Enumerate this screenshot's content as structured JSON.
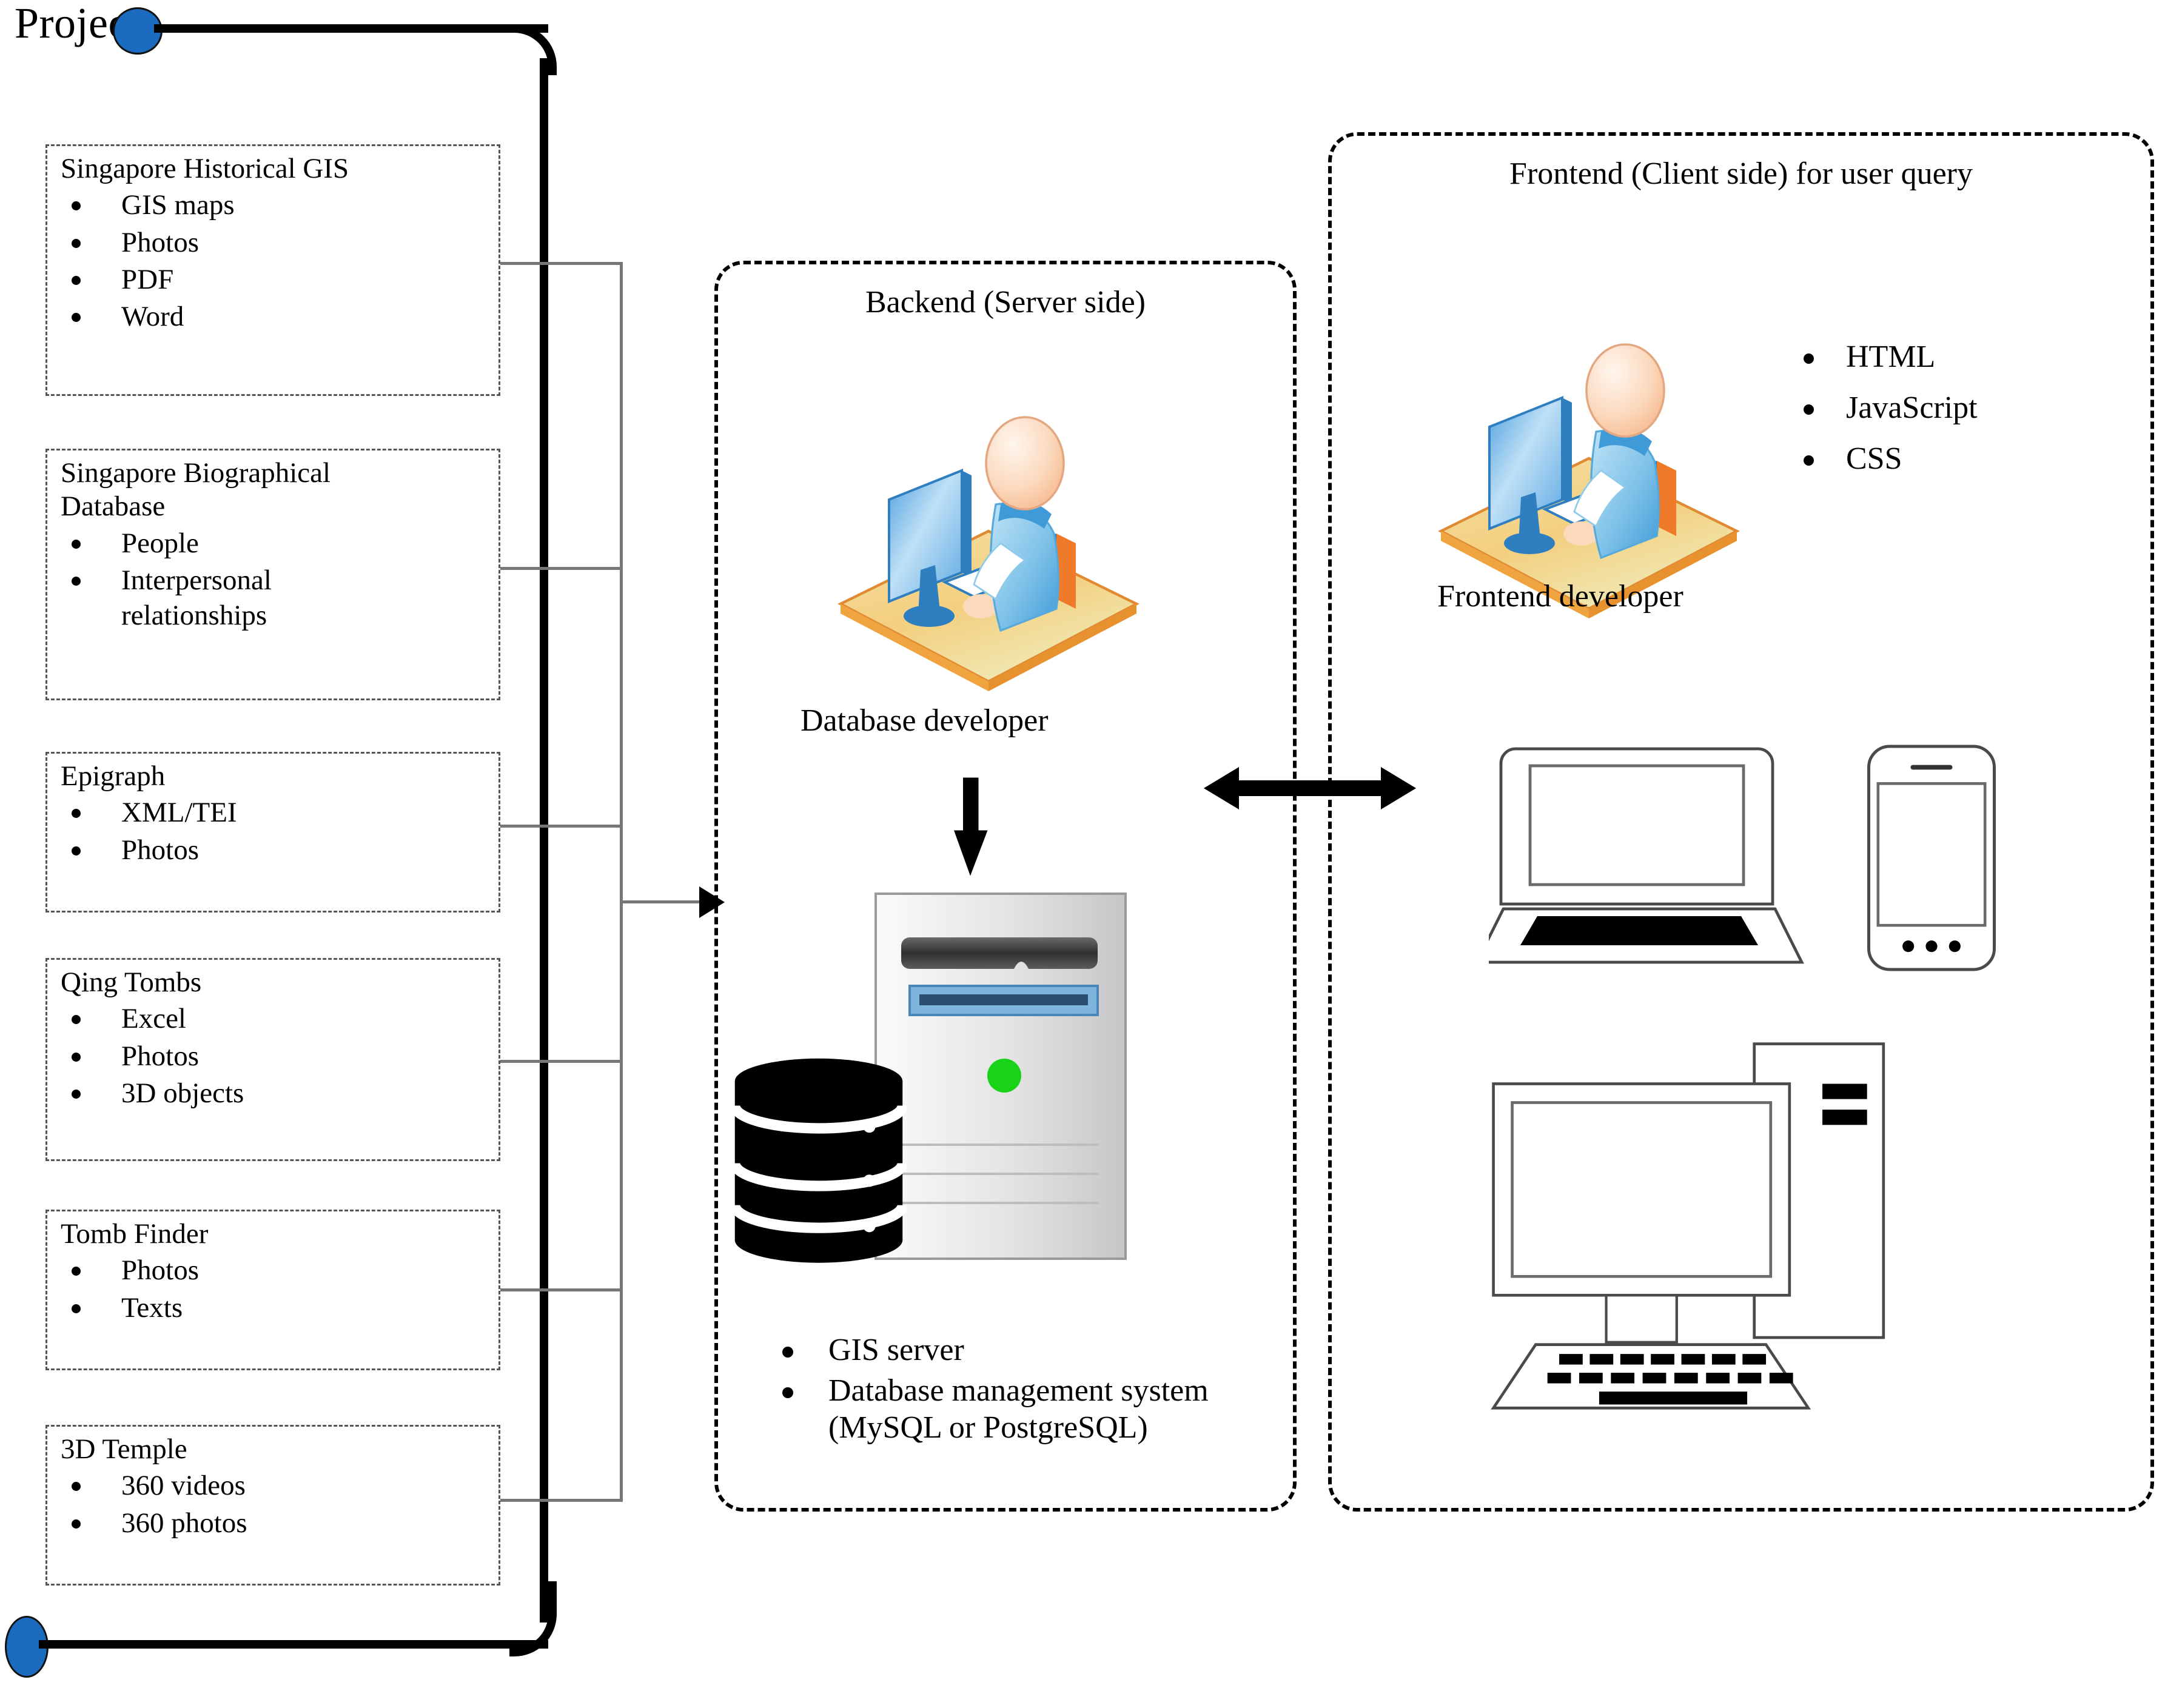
{
  "diagram": {
    "title": "Projects",
    "accent_blue": "#1b6cc0",
    "line_black": "#000000",
    "line_grey": "#777777"
  },
  "projects": [
    {
      "name": "Singapore Historical GIS",
      "items": [
        "GIS maps",
        "Photos",
        "PDF",
        "Word"
      ]
    },
    {
      "name": "Singapore Biographical\nDatabase",
      "items": [
        "People",
        "Interpersonal\nrelationships"
      ]
    },
    {
      "name": "Epigraph",
      "items": [
        "XML/TEI",
        "Photos"
      ]
    },
    {
      "name": "Qing Tombs",
      "items": [
        "Excel",
        "Photos",
        "3D objects"
      ]
    },
    {
      "name": "Tomb Finder",
      "items": [
        "Photos",
        "Texts"
      ]
    },
    {
      "name": "3D Temple",
      "items": [
        "360 videos",
        "360 photos"
      ]
    }
  ],
  "backend": {
    "title": "Backend (Server side)",
    "developer_caption": "Database developer",
    "server_items": [
      "GIS server",
      "Database management system (MySQL or PostgreSQL)"
    ],
    "status_led_color": "#18d318"
  },
  "frontend": {
    "title": "Frontend (Client side) for user query",
    "developer_caption": "Frontend developer",
    "tech_items": [
      "HTML",
      "JavaScript",
      "CSS"
    ],
    "devices": [
      "laptop-icon",
      "smartphone-icon",
      "desktop-computer-icon"
    ]
  },
  "connectors": {
    "projects_to_backend": "arrow-right",
    "developer_to_server": "arrow-down",
    "backend_to_frontend": "arrow-left-right"
  }
}
